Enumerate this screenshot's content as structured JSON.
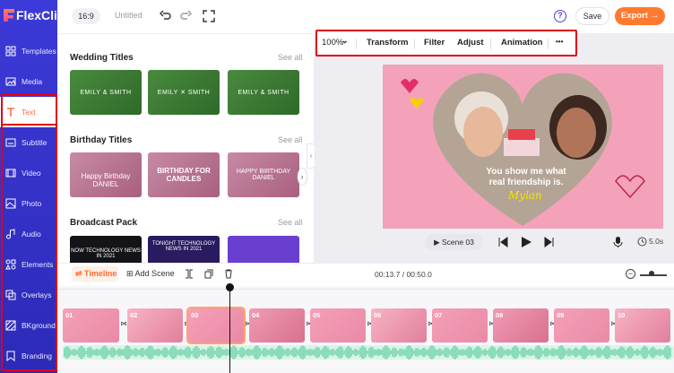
{
  "brand": {
    "name": "FlexClip",
    "accent": "#ff7a30",
    "sidebar_color": "#3c3ad8",
    "highlight": "#e0001b"
  },
  "sidebar": {
    "items": [
      {
        "label": "Templates",
        "icon": "templates-icon"
      },
      {
        "label": "Media",
        "icon": "media-icon"
      },
      {
        "label": "Text",
        "icon": "text-icon",
        "active": true
      },
      {
        "label": "Subtitle",
        "icon": "subtitle-icon"
      },
      {
        "label": "Video",
        "icon": "video-icon"
      },
      {
        "label": "Photo",
        "icon": "photo-icon"
      },
      {
        "label": "Audio",
        "icon": "audio-icon"
      },
      {
        "label": "Elements",
        "icon": "elements-icon"
      },
      {
        "label": "Overlays",
        "icon": "overlays-icon"
      },
      {
        "label": "BKground",
        "icon": "background-icon"
      },
      {
        "label": "Branding",
        "icon": "branding-icon"
      }
    ]
  },
  "topbar": {
    "ratio": "16:9",
    "title": "Untitled",
    "save": "Save",
    "export": "Export →",
    "help": "?"
  },
  "panel": {
    "sections": [
      {
        "title": "Wedding Titles",
        "see_all": "See all",
        "thumbs": [
          "EMILY & SMITH",
          "EMILY ✕ SMITH",
          "EMILY & SMITH"
        ]
      },
      {
        "title": "Birthday Titles",
        "see_all": "See all",
        "thumbs": [
          "Happy Birthday DANIEL",
          "BIRTHDAY FOR CANDLES",
          "HAPPY BIRTHDAY DANIEL"
        ]
      },
      {
        "title": "Broadcast Pack",
        "see_all": "See all",
        "thumbs": [
          "NOW TECHNOLOGY NEWS IN 2021",
          "TONIGHT TECHNOLOGY NEWS IN 2021",
          ""
        ]
      }
    ]
  },
  "canvas_toolbar": {
    "zoom": "100%",
    "transform": "Transform",
    "filter": "Filter",
    "adjust": "Adjust",
    "animation": "Animation",
    "more": "•••"
  },
  "preview": {
    "caption_line1": "You show me what",
    "caption_line2": "real friendship is.",
    "signature": "Mylan"
  },
  "controls": {
    "scene": "Scene 03",
    "duration": "5.0s"
  },
  "timeline": {
    "label": "Timeline",
    "add_scene": "Add Scene",
    "time": "00:13.7 / 00:50.0",
    "clips": [
      "01",
      "02",
      "03",
      "04",
      "05",
      "06",
      "07",
      "08",
      "09",
      "10"
    ],
    "selected_clip": "03"
  }
}
